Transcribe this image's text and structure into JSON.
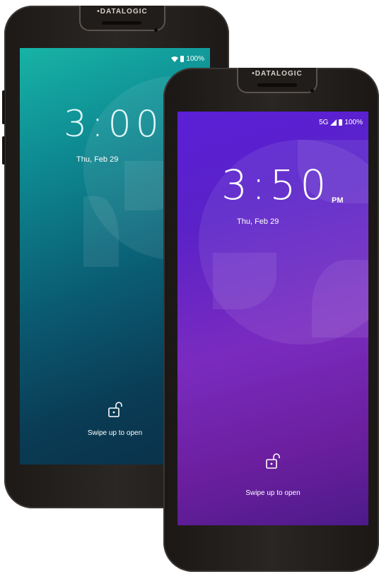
{
  "back_phone": {
    "brand": "•DATALOGIC",
    "status": {
      "battery": "100%",
      "wifi_icon": "wifi-icon"
    },
    "time": "3:00",
    "date": "Thu, Feb 29",
    "swipe_text": "Swipe up to open",
    "colors": {
      "top": "#17b3a6",
      "bottom": "#0b3049"
    }
  },
  "front_phone": {
    "brand": "•DATALOGIC",
    "status": {
      "network": "5G",
      "battery": "100%"
    },
    "time": "3:50",
    "ampm": "PM",
    "date": "Thu, Feb 29",
    "swipe_text": "Swipe up to open",
    "colors": {
      "top": "#5b1fd6",
      "bottom": "#4d1a8a"
    }
  }
}
